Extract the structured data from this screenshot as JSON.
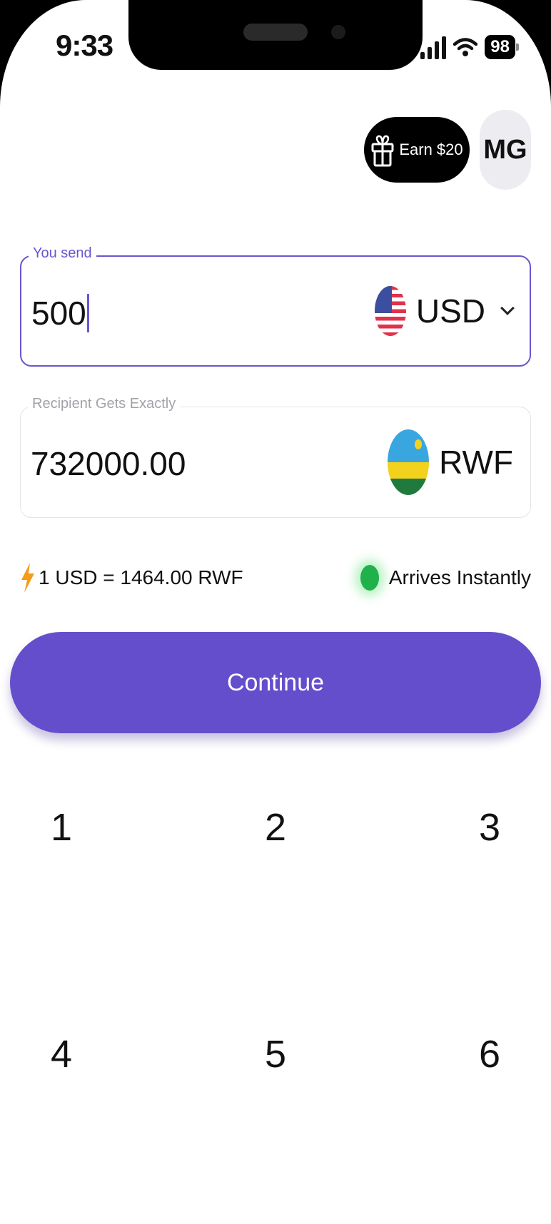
{
  "status_bar": {
    "time": "9:33",
    "battery": "98"
  },
  "header": {
    "earn_label": "Earn $20",
    "avatar_initials": "MG"
  },
  "send": {
    "label": "You send",
    "amount": "500",
    "currency": "USD"
  },
  "receive": {
    "label": "Recipient Gets Exactly",
    "amount": "732000.00",
    "currency": "RWF"
  },
  "info": {
    "rate": "1 USD = 1464.00 RWF",
    "arrival": "Arrives Instantly"
  },
  "actions": {
    "continue_label": "Continue"
  },
  "keypad": {
    "keys": [
      "1",
      "2",
      "3",
      "4",
      "5",
      "6"
    ]
  },
  "colors": {
    "accent": "#654ecb",
    "success": "#20b14a",
    "bolt": "#f59a1b"
  }
}
